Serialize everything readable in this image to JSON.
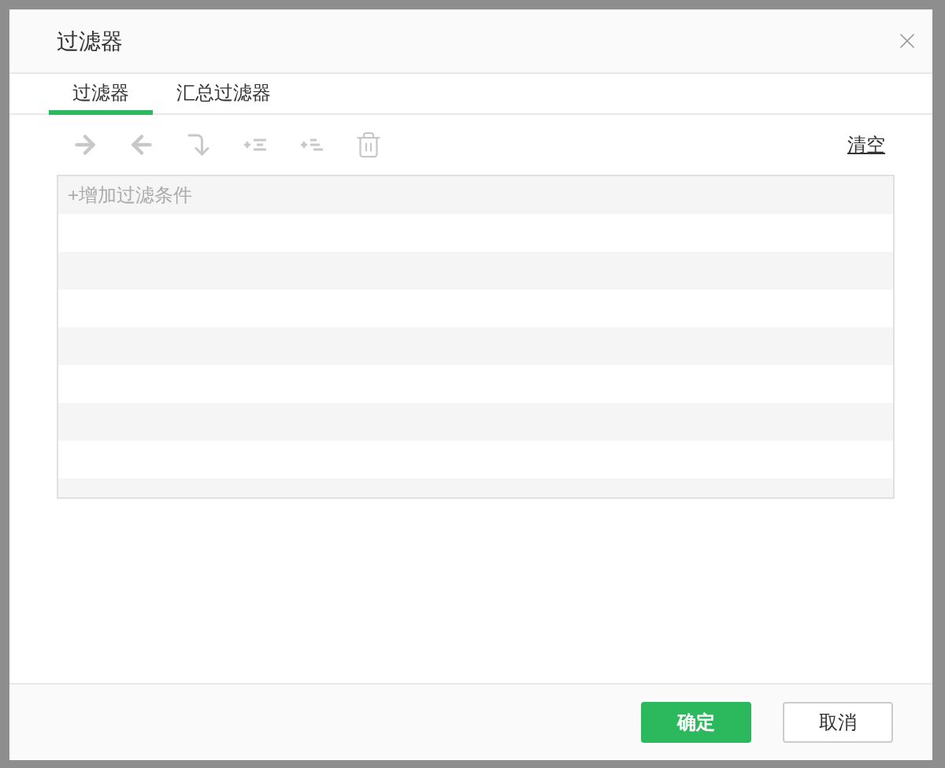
{
  "dialog": {
    "title": "过滤器",
    "tabs": [
      {
        "label": "过滤器",
        "selected": true
      },
      {
        "label": "汇总过滤器",
        "selected": false
      }
    ],
    "toolbar": [
      {
        "kind": "right",
        "disabled": true
      },
      {
        "kind": "left",
        "disabled": true
      },
      {
        "kind": "corner",
        "disabled": true
      },
      {
        "kind": "insert",
        "disabled": true
      },
      {
        "kind": "append",
        "disabled": true
      },
      {
        "kind": "delete",
        "disabled": true
      }
    ],
    "clear_link": "清空",
    "add_condition": "+增加过滤条件",
    "buttons": [
      {
        "label": "确定",
        "kind": "primary"
      },
      {
        "label": "取消",
        "kind": "secondary"
      }
    ]
  }
}
